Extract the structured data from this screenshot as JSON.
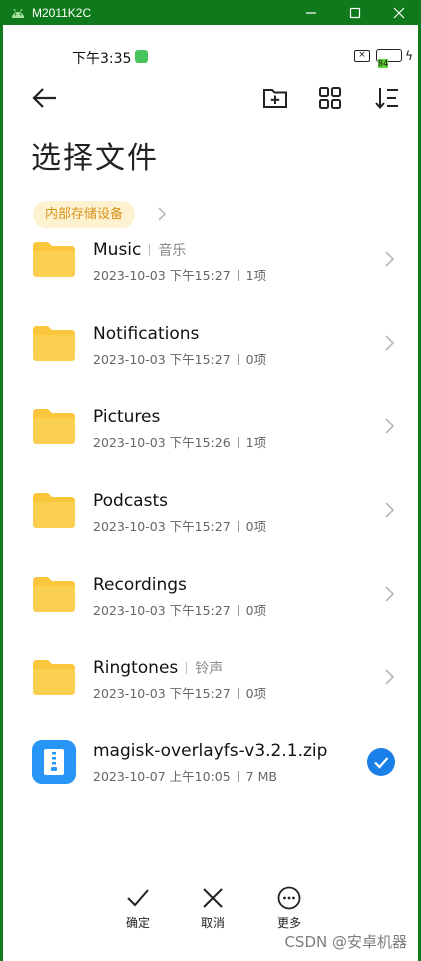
{
  "window": {
    "title": "M2011K2C",
    "accent": "#0e7a1b"
  },
  "status": {
    "time": "下午3:35",
    "battery": "84"
  },
  "toolbar": {
    "icons": [
      "back-arrow-icon",
      "new-folder-icon",
      "grid-view-icon",
      "sort-icon"
    ]
  },
  "page": {
    "title": "选择文件",
    "location": "内部存储设备"
  },
  "files": [
    {
      "name": "Music",
      "tag": "音乐",
      "date": "2023-10-03 下午15:27",
      "count": "1项",
      "type": "folder"
    },
    {
      "name": "Notifications",
      "tag": "",
      "date": "2023-10-03 下午15:27",
      "count": "0项",
      "type": "folder"
    },
    {
      "name": "Pictures",
      "tag": "",
      "date": "2023-10-03 下午15:26",
      "count": "1项",
      "type": "folder"
    },
    {
      "name": "Podcasts",
      "tag": "",
      "date": "2023-10-03 下午15:27",
      "count": "0项",
      "type": "folder"
    },
    {
      "name": "Recordings",
      "tag": "",
      "date": "2023-10-03 下午15:27",
      "count": "0项",
      "type": "folder"
    },
    {
      "name": "Ringtones",
      "tag": "铃声",
      "date": "2023-10-03 下午15:27",
      "count": "0项",
      "type": "folder"
    },
    {
      "name": "magisk-overlayfs-v3.2.1.zip",
      "tag": "",
      "date": "2023-10-07 上午10:05",
      "count": "7 MB",
      "type": "zip",
      "selected": true
    }
  ],
  "bottom": {
    "confirm": "确定",
    "cancel": "取消",
    "more": "更多"
  },
  "watermark": "CSDN @安卓机器",
  "colors": {
    "folder": "#f9c63c",
    "zip": "#2896f6",
    "check": "#1a7fe6",
    "chip_bg": "#fdf1cf",
    "chip_text": "#d7931b"
  }
}
